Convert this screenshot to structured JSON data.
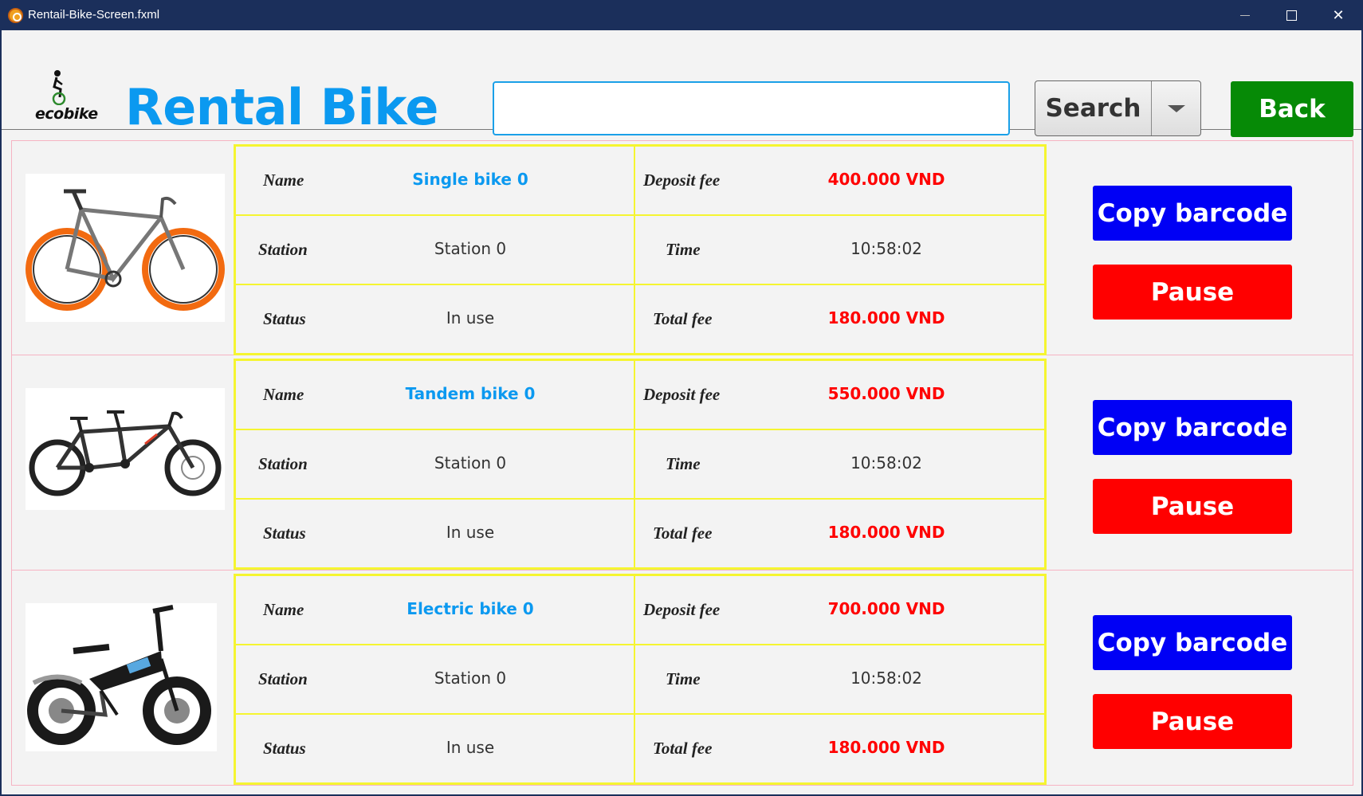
{
  "window": {
    "title": "Rentail-Bike-Screen.fxml",
    "minimize_label": "",
    "maximize_label": "",
    "close_label": "✕"
  },
  "header": {
    "logo_text": "ecobike",
    "title": "Rental Bike",
    "search_value": "",
    "search_label": "Search",
    "back_label": "Back"
  },
  "labels": {
    "name": "Name",
    "station": "Station",
    "status": "Status",
    "deposit": "Deposit fee",
    "time": "Time",
    "total": "Total fee",
    "copy": "Copy barcode",
    "pause": "Pause"
  },
  "colors": {
    "accent": "#0b99f0",
    "back": "#068a06",
    "copy": "#0000f5",
    "pause": "#ff0000",
    "fee": "#ff0000",
    "row_border": "#f6b3c2",
    "cell_border": "#f5f530"
  },
  "bikes": [
    {
      "name": "Single bike 0",
      "station": "Station 0",
      "status": "In use",
      "deposit": "400.000 VND",
      "time": "10:58:02",
      "total": "180.000 VND",
      "image": "single-bike-icon"
    },
    {
      "name": "Tandem bike 0",
      "station": "Station 0",
      "status": "In use",
      "deposit": "550.000 VND",
      "time": "10:58:02",
      "total": "180.000 VND",
      "image": "tandem-bike-icon"
    },
    {
      "name": "Electric bike 0",
      "station": "Station 0",
      "status": "In use",
      "deposit": "700.000 VND",
      "time": "10:58:02",
      "total": "180.000 VND",
      "image": "electric-bike-icon"
    }
  ]
}
